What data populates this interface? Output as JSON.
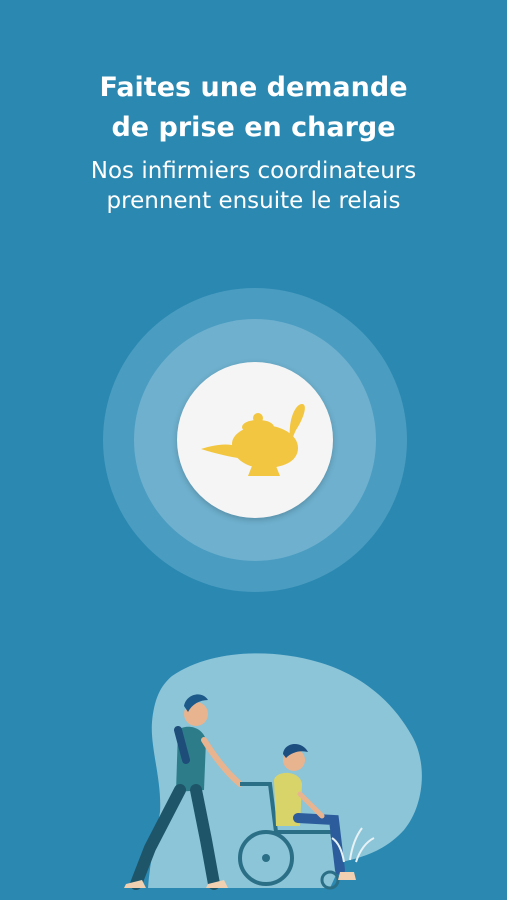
{
  "colors": {
    "background": "#2A88B1",
    "ring_outer": "#4A9CC1",
    "ring_inner": "#6EB0CE",
    "center_disc": "#F5F5F5",
    "lamp_gold": "#F2C640",
    "blob": "#8CC4D8"
  },
  "onboarding": {
    "title_line1": "Faites une demande",
    "title_line2": "de prise en charge",
    "subtitle_line1": "Nos infirmiers coordinateurs",
    "subtitle_line2": "prennent ensuite le relais"
  },
  "icons": {
    "center": "oil-lamp-icon"
  }
}
